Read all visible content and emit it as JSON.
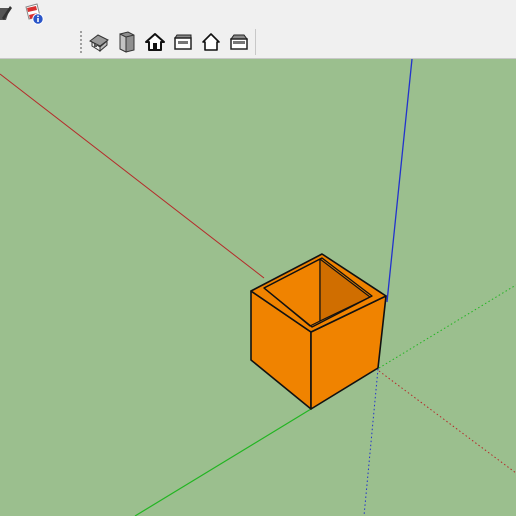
{
  "toolbars": {
    "top_row": [
      {
        "icon": "style-pencil-icon"
      },
      {
        "icon": "model-info-icon"
      }
    ],
    "views": [
      {
        "icon": "iso-view-icon"
      },
      {
        "icon": "top-view-icon"
      },
      {
        "icon": "front-view-icon"
      },
      {
        "icon": "right-view-icon"
      },
      {
        "icon": "back-view-icon"
      },
      {
        "icon": "left-view-icon"
      }
    ]
  },
  "viewport": {
    "background": "#9bbf8e",
    "axes": {
      "red": "#b52a2a",
      "green": "#22b522",
      "blue": "#2233cc"
    },
    "model": {
      "type": "open-box",
      "face_color": "#f08300",
      "inner_shadow": "#d06e00"
    }
  }
}
